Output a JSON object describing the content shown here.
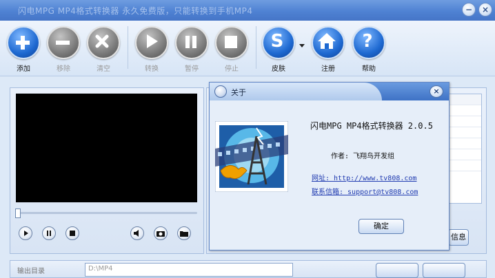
{
  "window": {
    "title": "闪电MPG MP4格式转换器  永久免费版，只能转换到手机MP4"
  },
  "toolbar": {
    "add": "添加",
    "remove": "移除",
    "clear": "清空",
    "convert": "转换",
    "pause": "暂停",
    "stop": "停止",
    "skin": "皮肤",
    "register": "注册",
    "help": "帮助"
  },
  "player": {
    "seek_progress": 0
  },
  "right_panel": {
    "info_button": "信息"
  },
  "bottom": {
    "output_label": "输出目录",
    "output_path": "D:\\MP4"
  },
  "about": {
    "title": "关于",
    "product": "闪电MPG MP4格式转换器 2.0.5",
    "author": "作者: 飞翔鸟开发组",
    "website": "网址: http://www.tv808.com",
    "email": "联系信箱: support@tv808.com",
    "ok": "确定"
  },
  "colors": {
    "accent": "#1e69d1",
    "titlebar": "#4f82d3",
    "link": "#1f3ab0"
  }
}
